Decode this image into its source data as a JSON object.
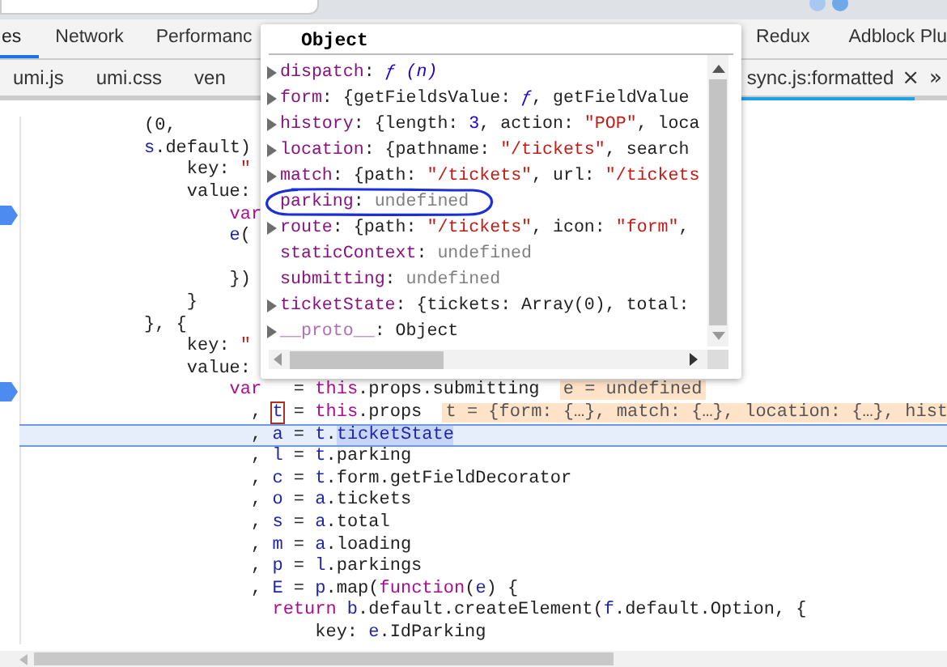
{
  "panel_tabs": [
    {
      "label": "es",
      "selected": true
    },
    {
      "label": "Network",
      "selected": false
    },
    {
      "label": "Performanc",
      "selected": false
    },
    {
      "label": "Redux",
      "selected": false
    },
    {
      "label": "Adblock Plu",
      "selected": false
    }
  ],
  "file_tabs": {
    "left": [
      "umi.js",
      "umi.css",
      "ven"
    ],
    "active": {
      "label": "sync.js:formatted",
      "close": "×"
    },
    "more": "»"
  },
  "code_lines": [
    {
      "kind": "code",
      "breakpoint": false,
      "current": false,
      "tokens": [
        {
          "kind": "plain",
          "t": "(0,"
        }
      ]
    },
    {
      "kind": "code",
      "breakpoint": false,
      "current": false,
      "tokens": [
        {
          "kind": "variable",
          "t": "s"
        },
        {
          "kind": "plain",
          "t": ".default)"
        }
      ]
    },
    {
      "kind": "code",
      "breakpoint": false,
      "current": false,
      "tokens": [
        {
          "kind": "plain",
          "t": "    key:"
        },
        {
          "kind": "string",
          "t": " \""
        }
      ]
    },
    {
      "kind": "code",
      "breakpoint": false,
      "current": false,
      "tokens": [
        {
          "kind": "plain",
          "t": "    value:"
        }
      ]
    },
    {
      "kind": "code",
      "breakpoint": true,
      "current": false,
      "tokens": [
        {
          "kind": "keyword",
          "t": "        var"
        }
      ]
    },
    {
      "kind": "code",
      "breakpoint": false,
      "current": false,
      "tokens": [
        {
          "kind": "variable",
          "t": "        e"
        },
        {
          "kind": "plain",
          "t": "("
        }
      ]
    },
    {
      "kind": "blank",
      "breakpoint": false,
      "current": false
    },
    {
      "kind": "code",
      "breakpoint": false,
      "current": false,
      "tokens": [
        {
          "kind": "plain",
          "t": "        })"
        }
      ]
    },
    {
      "kind": "code",
      "breakpoint": false,
      "current": false,
      "tokens": [
        {
          "kind": "plain",
          "t": "    }"
        }
      ]
    },
    {
      "kind": "code",
      "breakpoint": false,
      "current": false,
      "tokens": [
        {
          "kind": "plain",
          "t": "}, {"
        }
      ]
    },
    {
      "kind": "code",
      "breakpoint": false,
      "current": false,
      "tokens": [
        {
          "kind": "plain",
          "t": "    key:"
        },
        {
          "kind": "string",
          "t": " \""
        }
      ]
    },
    {
      "kind": "code",
      "breakpoint": false,
      "current": false,
      "tokens": [
        {
          "kind": "plain",
          "t": "    value:"
        }
      ]
    },
    {
      "kind": "code",
      "breakpoint": true,
      "current": false,
      "tokens": [
        {
          "kind": "keyword",
          "t": "        var"
        },
        {
          "kind": "plain",
          "t": "   = "
        },
        {
          "kind": "keyword",
          "t": "this"
        },
        {
          "kind": "plain",
          "t": ".props.submitting"
        }
      ],
      "hint": "e = undefined"
    },
    {
      "kind": "code",
      "breakpoint": false,
      "current": false,
      "tokens": [
        {
          "kind": "plain",
          "t": "          , "
        },
        {
          "kind": "hovered",
          "t": "t"
        },
        {
          "kind": "plain",
          "t": " = "
        },
        {
          "kind": "keyword",
          "t": "this"
        },
        {
          "kind": "plain",
          "t": ".props"
        }
      ],
      "hint": "t = {form: {…}, match: {…}, location: {…}, hist"
    },
    {
      "kind": "code",
      "breakpoint": false,
      "current": true,
      "tokens": [
        {
          "kind": "plain",
          "t": "          , "
        },
        {
          "kind": "variable",
          "t": "a"
        },
        {
          "kind": "plain",
          "t": " = "
        },
        {
          "kind": "variable",
          "t": "t"
        },
        {
          "kind": "plain",
          "t": "."
        },
        {
          "kind": "selected",
          "t": "ticketState"
        }
      ]
    },
    {
      "kind": "code",
      "breakpoint": false,
      "current": false,
      "tokens": [
        {
          "kind": "plain",
          "t": "          , "
        },
        {
          "kind": "variable",
          "t": "l"
        },
        {
          "kind": "plain",
          "t": " = "
        },
        {
          "kind": "variable",
          "t": "t"
        },
        {
          "kind": "plain",
          "t": ".parking"
        }
      ]
    },
    {
      "kind": "code",
      "breakpoint": false,
      "current": false,
      "tokens": [
        {
          "kind": "plain",
          "t": "          , "
        },
        {
          "kind": "variable",
          "t": "c"
        },
        {
          "kind": "plain",
          "t": " = "
        },
        {
          "kind": "variable",
          "t": "t"
        },
        {
          "kind": "plain",
          "t": ".form.getFieldDecorator"
        }
      ]
    },
    {
      "kind": "code",
      "breakpoint": false,
      "current": false,
      "tokens": [
        {
          "kind": "plain",
          "t": "          , "
        },
        {
          "kind": "variable",
          "t": "o"
        },
        {
          "kind": "plain",
          "t": " = "
        },
        {
          "kind": "variable",
          "t": "a"
        },
        {
          "kind": "plain",
          "t": ".tickets"
        }
      ]
    },
    {
      "kind": "code",
      "breakpoint": false,
      "current": false,
      "tokens": [
        {
          "kind": "plain",
          "t": "          , "
        },
        {
          "kind": "variable",
          "t": "s"
        },
        {
          "kind": "plain",
          "t": " = "
        },
        {
          "kind": "variable",
          "t": "a"
        },
        {
          "kind": "plain",
          "t": ".total"
        }
      ]
    },
    {
      "kind": "code",
      "breakpoint": false,
      "current": false,
      "tokens": [
        {
          "kind": "plain",
          "t": "          , "
        },
        {
          "kind": "variable",
          "t": "m"
        },
        {
          "kind": "plain",
          "t": " = "
        },
        {
          "kind": "variable",
          "t": "a"
        },
        {
          "kind": "plain",
          "t": ".loading"
        }
      ]
    },
    {
      "kind": "code",
      "breakpoint": false,
      "current": false,
      "tokens": [
        {
          "kind": "plain",
          "t": "          , "
        },
        {
          "kind": "variable",
          "t": "p"
        },
        {
          "kind": "plain",
          "t": " = "
        },
        {
          "kind": "variable",
          "t": "l"
        },
        {
          "kind": "plain",
          "t": ".parkings"
        }
      ]
    },
    {
      "kind": "code",
      "breakpoint": false,
      "current": false,
      "tokens": [
        {
          "kind": "plain",
          "t": "          , "
        },
        {
          "kind": "variable",
          "t": "E"
        },
        {
          "kind": "plain",
          "t": " = "
        },
        {
          "kind": "variable",
          "t": "p"
        },
        {
          "kind": "plain",
          "t": ".map("
        },
        {
          "kind": "keyword",
          "t": "function"
        },
        {
          "kind": "plain",
          "t": "("
        },
        {
          "kind": "variable",
          "t": "e"
        },
        {
          "kind": "plain",
          "t": ") {"
        }
      ]
    },
    {
      "kind": "code",
      "breakpoint": false,
      "current": false,
      "tokens": [
        {
          "kind": "keyword",
          "t": "            return"
        },
        {
          "kind": "variable",
          "t": " b"
        },
        {
          "kind": "plain",
          "t": ".default.createElement("
        },
        {
          "kind": "variable",
          "t": "f"
        },
        {
          "kind": "plain",
          "t": ".default.Option, {"
        }
      ]
    },
    {
      "kind": "code",
      "breakpoint": false,
      "current": false,
      "tokens": [
        {
          "kind": "plain",
          "t": "                key: "
        },
        {
          "kind": "variable",
          "t": "e"
        },
        {
          "kind": "plain",
          "t": ".IdParking"
        }
      ]
    }
  ],
  "popover": {
    "title": "Object",
    "rows": [
      {
        "name": "dispatch",
        "expandable": true,
        "dimmed": false,
        "value": [
          {
            "kind": "plain",
            "t": ": "
          },
          {
            "kind": "function",
            "t": "ƒ (n)"
          }
        ]
      },
      {
        "name": "form",
        "expandable": true,
        "dimmed": false,
        "value": [
          {
            "kind": "plain",
            "t": ": {getFieldsValue: "
          },
          {
            "kind": "function",
            "t": "ƒ"
          },
          {
            "kind": "plain",
            "t": ", getFieldValue"
          }
        ]
      },
      {
        "name": "history",
        "expandable": true,
        "dimmed": false,
        "value": [
          {
            "kind": "plain",
            "t": ": {length: "
          },
          {
            "kind": "number",
            "t": "3"
          },
          {
            "kind": "plain",
            "t": ", action: "
          },
          {
            "kind": "string",
            "t": "\"POP\""
          },
          {
            "kind": "plain",
            "t": ", loca"
          }
        ]
      },
      {
        "name": "location",
        "expandable": true,
        "dimmed": false,
        "value": [
          {
            "kind": "plain",
            "t": ": {pathname: "
          },
          {
            "kind": "string",
            "t": "\"/tickets\""
          },
          {
            "kind": "plain",
            "t": ", search"
          }
        ]
      },
      {
        "name": "match",
        "expandable": true,
        "dimmed": false,
        "value": [
          {
            "kind": "plain",
            "t": ": {path: "
          },
          {
            "kind": "string",
            "t": "\"/tickets\""
          },
          {
            "kind": "plain",
            "t": ", url: "
          },
          {
            "kind": "string",
            "t": "\"/tickets"
          }
        ]
      },
      {
        "name": "parking",
        "expandable": false,
        "dimmed": false,
        "value": [
          {
            "kind": "plain",
            "t": ": "
          },
          {
            "kind": "undefined",
            "t": "undefined"
          }
        ]
      },
      {
        "name": "route",
        "expandable": true,
        "dimmed": false,
        "value": [
          {
            "kind": "plain",
            "t": ": {path: "
          },
          {
            "kind": "string",
            "t": "\"/tickets\""
          },
          {
            "kind": "plain",
            "t": ", icon: "
          },
          {
            "kind": "string",
            "t": "\"form\""
          },
          {
            "kind": "plain",
            "t": ","
          }
        ]
      },
      {
        "name": "staticContext",
        "expandable": false,
        "dimmed": false,
        "value": [
          {
            "kind": "plain",
            "t": ": "
          },
          {
            "kind": "undefined",
            "t": "undefined"
          }
        ]
      },
      {
        "name": "submitting",
        "expandable": false,
        "dimmed": false,
        "value": [
          {
            "kind": "plain",
            "t": ": "
          },
          {
            "kind": "undefined",
            "t": "undefined"
          }
        ]
      },
      {
        "name": "ticketState",
        "expandable": true,
        "dimmed": false,
        "value": [
          {
            "kind": "plain",
            "t": ": {tickets: Array(0), total:"
          }
        ]
      },
      {
        "name": "__proto__",
        "expandable": true,
        "dimmed": true,
        "value": [
          {
            "kind": "plain",
            "t": ": Object"
          }
        ]
      }
    ]
  }
}
